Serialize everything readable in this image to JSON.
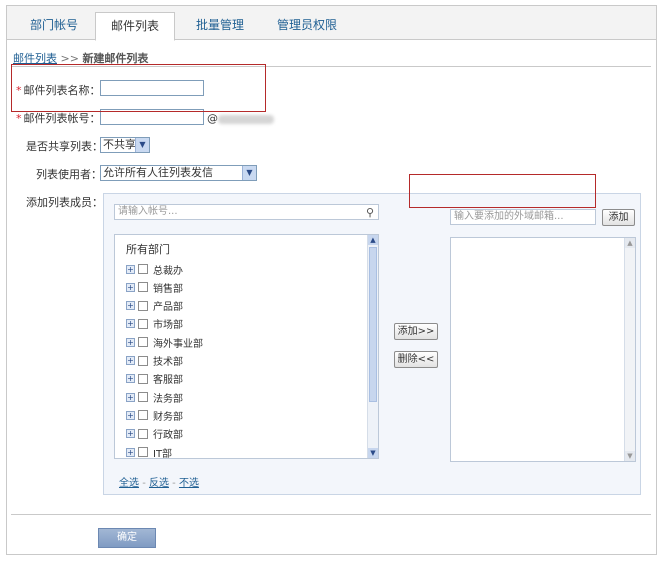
{
  "tabs": [
    {
      "label": "部门帐号"
    },
    {
      "label": "邮件列表"
    },
    {
      "label": "批量管理"
    },
    {
      "label": "管理员权限"
    }
  ],
  "breadcrumb": {
    "link": "邮件列表",
    "separator": ">>",
    "current": "新建邮件列表"
  },
  "form": {
    "required_mark": "*",
    "name_label": "邮件列表名称：",
    "name_value": "",
    "account_label": "邮件列表帐号：",
    "account_value": "",
    "at_sign": "@",
    "share_label": "是否共享列表：",
    "share_value": "不共享",
    "users_label": "列表使用者：",
    "users_value": "允许所有人往列表发信",
    "members_label": "添加列表成员："
  },
  "members": {
    "search_placeholder": "请输入帐号...",
    "tree_root": "所有部门",
    "departments": [
      "总裁办",
      "销售部",
      "产品部",
      "市场部",
      "海外事业部",
      "技术部",
      "客服部",
      "法务部",
      "财务部",
      "行政部",
      "IT部"
    ],
    "add_button": "添加>>",
    "remove_button": "删除<<",
    "external_placeholder": "输入要添加的外域邮箱...",
    "external_add_button": "添加",
    "select_all": "全选",
    "invert": "反选",
    "select_none": "不选",
    "link_sep": "-"
  },
  "confirm_button": "确定",
  "colors": {
    "accent": "#1f5f93",
    "required": "#d9232f",
    "highlight_box": "#b52a2a",
    "confirm_bg": "#8aa4c8"
  }
}
